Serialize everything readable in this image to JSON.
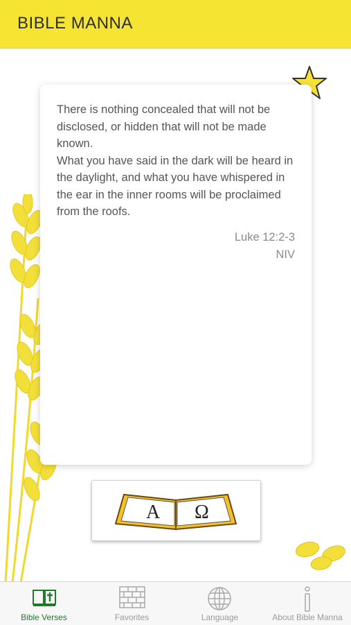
{
  "header": {
    "title": "BIBLE MANNA"
  },
  "verse": {
    "text": "There is nothing concealed that will not be disclosed, or hidden that will not be made known.\nWhat you have said in the dark will be heard in the daylight, and what you have whispered in the ear in the inner rooms will be proclaimed from the roofs.",
    "reference": "Luke 12:2-3",
    "version": "NIV"
  },
  "open_bible_button": {
    "letters": [
      "A",
      "Ω"
    ]
  },
  "tabs": [
    {
      "label": "Bible Verses",
      "icon": "bible-icon",
      "active": true
    },
    {
      "label": "Favorites",
      "icon": "brick-wall-icon",
      "active": false
    },
    {
      "label": "Language",
      "icon": "globe-icon",
      "active": false
    },
    {
      "label": "About Bible Manna",
      "icon": "info-icon",
      "active": false
    }
  ],
  "colors": {
    "header_bg": "#f5e431",
    "accent_yellow": "#f3dc2a",
    "active_tab": "#1f7a2a",
    "inactive_tab": "#9a9a9a"
  }
}
